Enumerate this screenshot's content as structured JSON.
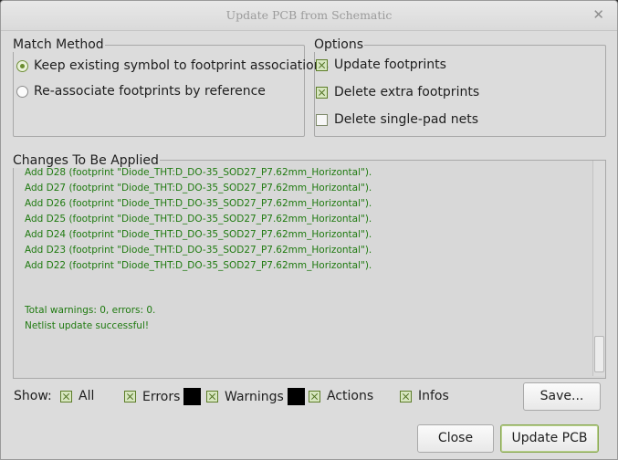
{
  "window": {
    "title": "Update PCB from Schematic"
  },
  "match_method": {
    "legend": "Match Method",
    "options": [
      {
        "label": "Keep existing symbol to footprint associations",
        "selected": true
      },
      {
        "label": "Re-associate footprints by reference",
        "selected": false
      }
    ]
  },
  "options": {
    "legend": "Options",
    "items": [
      {
        "label": "Update footprints",
        "checked": true
      },
      {
        "label": "Delete extra footprints",
        "checked": true
      },
      {
        "label": "Delete single-pad nets",
        "checked": false
      }
    ]
  },
  "changes": {
    "legend": "Changes To Be Applied",
    "lines": [
      "Add D28 (footprint \"Diode_THT:D_DO-35_SOD27_P7.62mm_Horizontal\").",
      "Add D27 (footprint \"Diode_THT:D_DO-35_SOD27_P7.62mm_Horizontal\").",
      "Add D26 (footprint \"Diode_THT:D_DO-35_SOD27_P7.62mm_Horizontal\").",
      "Add D25 (footprint \"Diode_THT:D_DO-35_SOD27_P7.62mm_Horizontal\").",
      "Add D24 (footprint \"Diode_THT:D_DO-35_SOD27_P7.62mm_Horizontal\").",
      "Add D23 (footprint \"Diode_THT:D_DO-35_SOD27_P7.62mm_Horizontal\").",
      "Add D22 (footprint \"Diode_THT:D_DO-35_SOD27_P7.62mm_Horizontal\")."
    ],
    "summary": "Total warnings: 0, errors: 0.",
    "result": "Netlist update successful!"
  },
  "show": {
    "label": "Show:",
    "filters": [
      {
        "label": "All",
        "checked": true
      },
      {
        "label": "Errors",
        "checked": true,
        "swatch": "#000000"
      },
      {
        "label": "Warnings",
        "checked": true,
        "swatch": "#000000"
      },
      {
        "label": "Actions",
        "checked": true
      },
      {
        "label": "Infos",
        "checked": true
      }
    ]
  },
  "buttons": {
    "save": "Save...",
    "close": "Close",
    "update": "Update PCB"
  },
  "colors": {
    "log_text": "#1f7a10",
    "accent": "#6a8c2f"
  }
}
